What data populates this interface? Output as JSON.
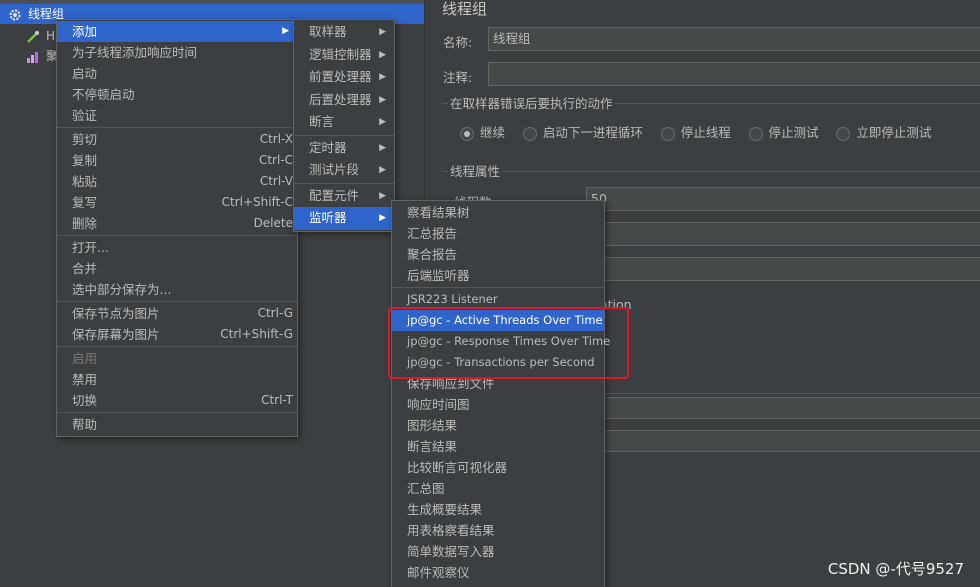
{
  "tree": {
    "nodes": [
      {
        "label": "线程组",
        "icon": "gear-icon"
      },
      {
        "label": "H",
        "icon": "pipette-icon"
      },
      {
        "label": "聚",
        "icon": "chart-icon"
      }
    ]
  },
  "panel": {
    "title": "线程组",
    "name_label": "名称:",
    "name_value": "线程组",
    "comment_label": "注释:",
    "comment_value": "",
    "error_group_title": "在取样器错误后要执行的动作",
    "error_actions": [
      "继续",
      "启动下一进程循环",
      "停止线程",
      "停止测试",
      "立即停止测试"
    ],
    "selected_action": "继续",
    "props_title": "线程属性",
    "thread_count_label": "线程数:",
    "thread_count_value": "50",
    "partial_text": "ation"
  },
  "context_menu": {
    "items": [
      {
        "label": "添加",
        "submenu": true,
        "selected": true
      },
      {
        "label": "为子线程添加响应时间"
      },
      {
        "label": "启动"
      },
      {
        "label": "不停顿启动"
      },
      {
        "label": "验证"
      },
      {
        "sep": true
      },
      {
        "label": "剪切",
        "shortcut": "Ctrl-X"
      },
      {
        "label": "复制",
        "shortcut": "Ctrl-C"
      },
      {
        "label": "粘贴",
        "shortcut": "Ctrl-V"
      },
      {
        "label": "复写",
        "shortcut": "Ctrl+Shift-C"
      },
      {
        "label": "删除",
        "shortcut": "Delete"
      },
      {
        "sep": true
      },
      {
        "label": "打开..."
      },
      {
        "label": "合并"
      },
      {
        "label": "选中部分保存为..."
      },
      {
        "sep": true
      },
      {
        "label": "保存节点为图片",
        "shortcut": "Ctrl-G"
      },
      {
        "label": "保存屏幕为图片",
        "shortcut": "Ctrl+Shift-G"
      },
      {
        "sep": true
      },
      {
        "label": "启用",
        "disabled": true
      },
      {
        "label": "禁用"
      },
      {
        "label": "切换",
        "shortcut": "Ctrl-T"
      },
      {
        "sep": true
      },
      {
        "label": "帮助"
      }
    ]
  },
  "add_submenu": {
    "items": [
      {
        "label": "取样器"
      },
      {
        "label": "逻辑控制器"
      },
      {
        "label": "前置处理器"
      },
      {
        "label": "后置处理器"
      },
      {
        "label": "断言"
      },
      {
        "label": "定时器"
      },
      {
        "label": "测试片段"
      },
      {
        "label": "配置元件"
      },
      {
        "label": "监听器",
        "selected": true
      }
    ]
  },
  "listener_submenu": {
    "items": [
      {
        "label": "察看结果树"
      },
      {
        "label": "汇总报告"
      },
      {
        "label": "聚合报告"
      },
      {
        "label": "后端监听器"
      },
      {
        "sep": true
      },
      {
        "label": "JSR223 Listener"
      },
      {
        "label": "jp@gc - Active Threads Over Time",
        "selected": true
      },
      {
        "label": "jp@gc - Response Times Over Time"
      },
      {
        "label": "jp@gc - Transactions per Second"
      },
      {
        "label": "保存响应到文件"
      },
      {
        "label": "响应时间图"
      },
      {
        "label": "图形结果"
      },
      {
        "label": "断言结果"
      },
      {
        "label": "比较断言可视化器"
      },
      {
        "label": "汇总图"
      },
      {
        "label": "生成概要结果"
      },
      {
        "label": "用表格察看结果"
      },
      {
        "label": "简单数据写入器"
      },
      {
        "label": "邮件观察仪"
      }
    ]
  },
  "colors": {
    "selection": "#2f65ca",
    "highlight_box": "#e0162b",
    "background": "#3c3f41"
  },
  "watermark": "CSDN @-代号9527"
}
